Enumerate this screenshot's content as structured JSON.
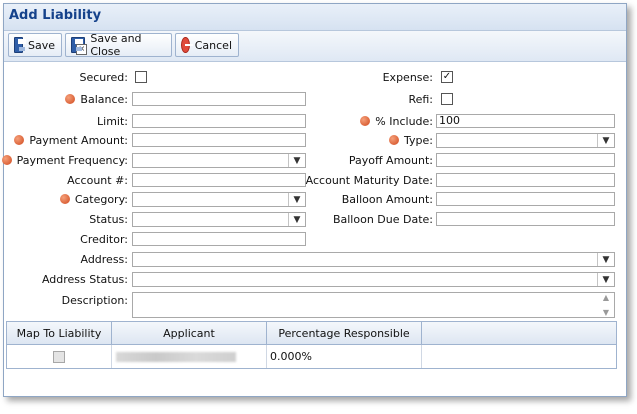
{
  "window": {
    "title": "Add Liability"
  },
  "toolbar": {
    "save": "Save",
    "save_close": "Save and Close",
    "cancel": "Cancel"
  },
  "left": {
    "secured": "Secured:",
    "balance": "Balance:",
    "limit": "Limit:",
    "payment_amount": "Payment Amount:",
    "payment_frequency": "Payment Frequency:",
    "account_number": "Account #:",
    "category": "Category:",
    "status": "Status:",
    "creditor": "Creditor:"
  },
  "right": {
    "expense": "Expense:",
    "refi": "Refi:",
    "include": "% Include:",
    "include_value": "100",
    "type": "Type:",
    "payoff_amount": "Payoff Amount:",
    "maturity_date": "Account Maturity Date:",
    "balloon_amount": "Balloon Amount:",
    "balloon_due": "Balloon Due Date:"
  },
  "wide": {
    "address": "Address:",
    "address_status": "Address Status:",
    "description": "Description:"
  },
  "checks": {
    "secured": false,
    "expense": true,
    "refi": false
  },
  "grid": {
    "headers": [
      "Map To Liability",
      "Applicant",
      "Percentage Responsible"
    ],
    "rows": [
      {
        "map": false,
        "applicant": "",
        "percentage": "0.000%"
      }
    ]
  },
  "colors": {
    "title": "#15428b",
    "required": "#d0481c",
    "border": "#9fb3cf"
  }
}
